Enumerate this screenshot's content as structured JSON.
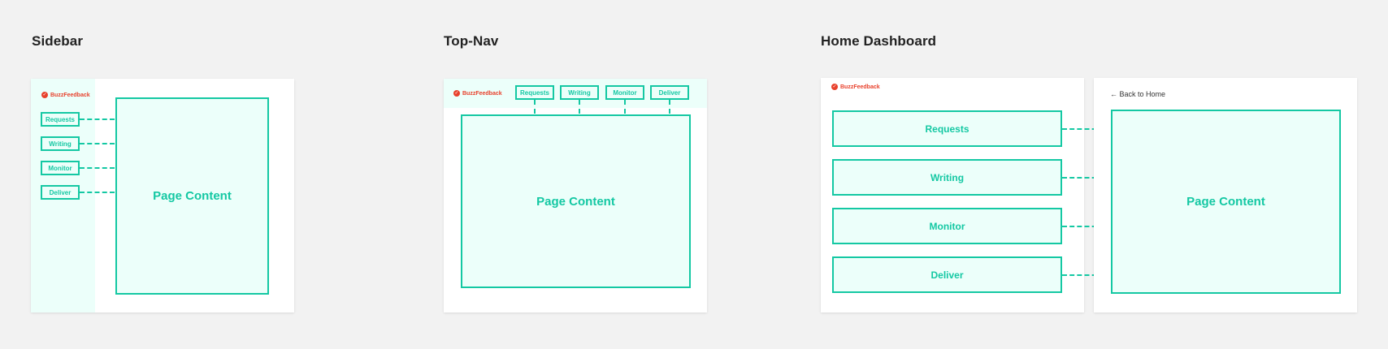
{
  "colors": {
    "background": "#f2f2f2",
    "accent": "#14c8a3",
    "accent_fill": "#ecfffa",
    "brand": "#e8412c",
    "title": "#222222"
  },
  "brand": {
    "name": "BuzzFeedback",
    "icon": "buzzfeedback-logo-icon"
  },
  "nav_items": [
    "Requests",
    "Writing",
    "Monitor",
    "Deliver"
  ],
  "sections": {
    "sidebar": {
      "title": "Sidebar",
      "content_label": "Page Content"
    },
    "topnav": {
      "title": "Top-Nav",
      "content_label": "Page Content"
    },
    "home": {
      "title": "Home Dashboard",
      "back_label": "← Back to Home",
      "content_label": "Page Content"
    }
  }
}
